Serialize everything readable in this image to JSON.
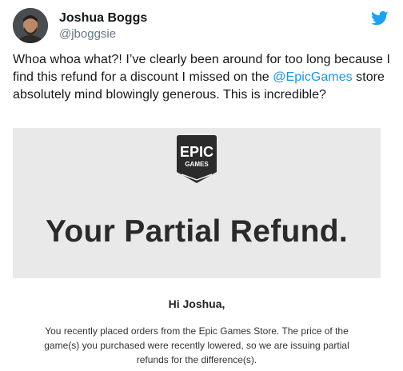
{
  "tweet": {
    "author_name": "Joshua Boggs",
    "author_handle": "@jboggsie",
    "text_before": "Whoa whoa what?! I’ve clearly been around for too long because I find this refund for a discount I missed on the ",
    "mention": "@EpicGames",
    "text_after": " store absolutely mind blowingly generous. This is incredible?"
  },
  "email": {
    "logo_line1": "EPIC",
    "logo_line2": "GAMES",
    "title": "Your Partial Refund.",
    "greeting": "Hi Joshua,",
    "body": "You recently placed orders from the Epic Games Store. The price of the game(s) you purchased were recently lowered, so we are issuing partial refunds for the difference(s)."
  },
  "icons": {
    "brand": "twitter-bird-icon",
    "brand_color": "#1da1f2",
    "mention_color": "#1b95e0"
  }
}
